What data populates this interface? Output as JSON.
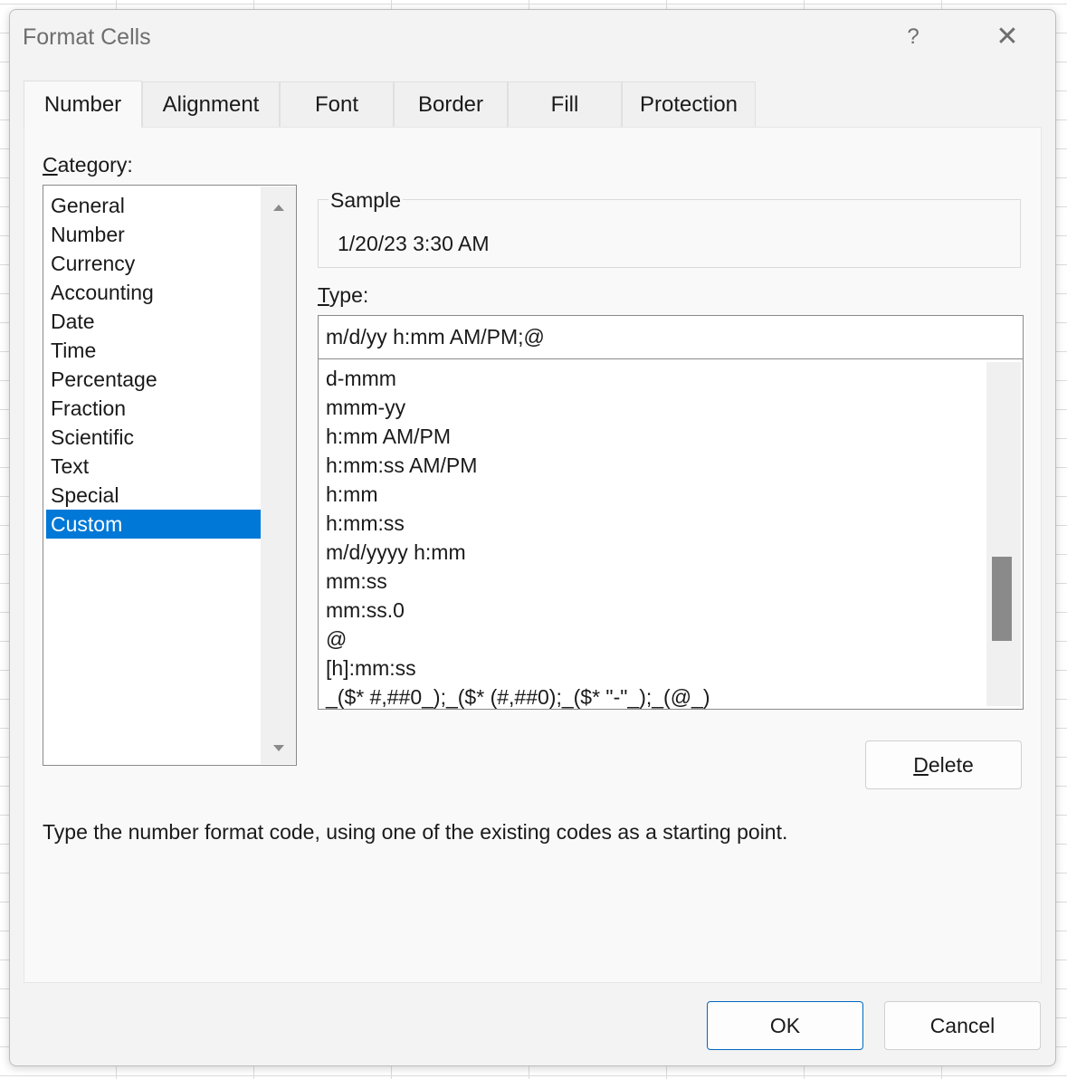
{
  "dialog": {
    "title": "Format Cells",
    "help_label": "?",
    "close_label": "✕"
  },
  "tabs": [
    {
      "label": "Number",
      "active": true
    },
    {
      "label": "Alignment"
    },
    {
      "label": "Font"
    },
    {
      "label": "Border"
    },
    {
      "label": "Fill"
    },
    {
      "label": "Protection"
    }
  ],
  "category": {
    "label_underlined": "C",
    "label_rest": "ategory:",
    "items": [
      "General",
      "Number",
      "Currency",
      "Accounting",
      "Date",
      "Time",
      "Percentage",
      "Fraction",
      "Scientific",
      "Text",
      "Special",
      "Custom"
    ],
    "selected": "Custom"
  },
  "sample": {
    "label": "Sample",
    "value": "1/20/23 3:30 AM"
  },
  "type": {
    "label_underlined": "T",
    "label_rest": "ype:",
    "value": "m/d/yy h:mm AM/PM;@",
    "items": [
      "d-mmm",
      "mmm-yy",
      "h:mm AM/PM",
      "h:mm:ss AM/PM",
      "h:mm",
      "h:mm:ss",
      "m/d/yyyy h:mm",
      "mm:ss",
      "mm:ss.0",
      "@",
      "[h]:mm:ss",
      "_($* #,##0_);_($* (#,##0);_($* \"-\"_);_(@_)"
    ]
  },
  "delete_button": {
    "underlined": "D",
    "rest": "elete"
  },
  "hint": "Type the number format code, using one of the existing codes as a starting point.",
  "footer": {
    "ok_label": "OK",
    "cancel_label": "Cancel"
  },
  "colors": {
    "selection": "#0078d7",
    "dialog_bg": "#f3f3f3"
  }
}
